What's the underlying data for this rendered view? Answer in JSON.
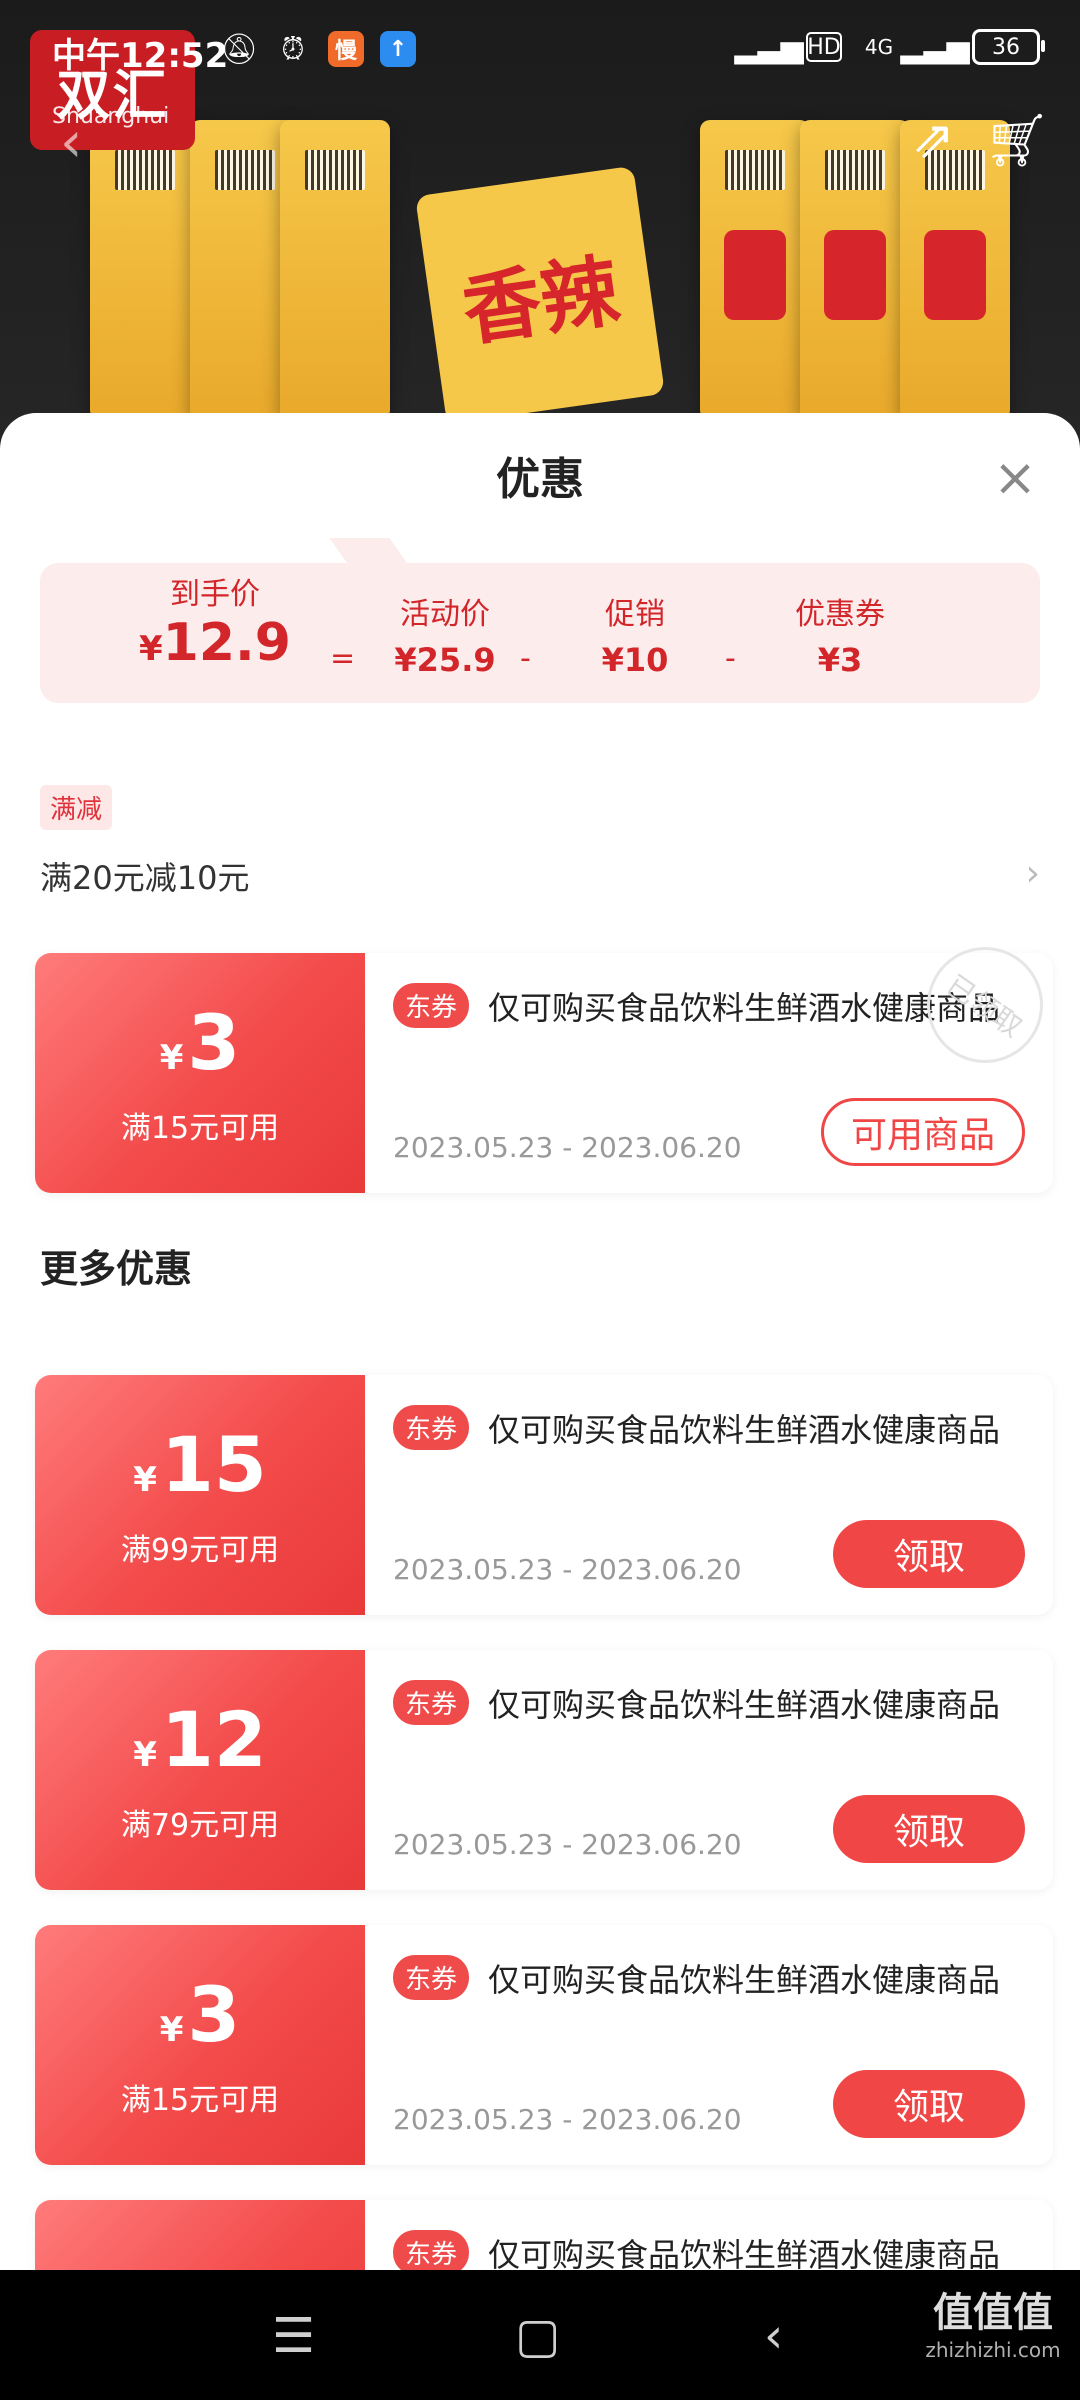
{
  "status_bar": {
    "time": "中午12:52",
    "app_badge": "慢",
    "network": "4G",
    "battery": "36"
  },
  "hero": {
    "logo": "双汇",
    "logo_sub": "Shuanghui",
    "text": "香辣"
  },
  "sheet": {
    "title": "优惠",
    "price_box": {
      "final_label": "到手价",
      "final_currency": "¥",
      "final_value": "12.9",
      "eq": "=",
      "activity_label": "活动价",
      "activity_value": "¥25.9",
      "minus": "-",
      "promo_label": "促销",
      "promo_value": "¥10",
      "coupon_label": "优惠券",
      "coupon_value": "¥3"
    },
    "tag": "满减",
    "rule": "满20元减10元",
    "more_title": "更多优惠"
  },
  "coupons": [
    {
      "amount": "3",
      "condition": "满15元可用",
      "badge": "东券",
      "description": "仅可购买食品饮料生鲜酒水健康商品",
      "date": "2023.05.23 - 2023.06.20",
      "button": "可用商品",
      "stamp": "已领取"
    },
    {
      "amount": "15",
      "condition": "满99元可用",
      "badge": "东券",
      "description": "仅可购买食品饮料生鲜酒水健康商品",
      "date": "2023.05.23 - 2023.06.20",
      "button": "领取"
    },
    {
      "amount": "12",
      "condition": "满79元可用",
      "badge": "东券",
      "description": "仅可购买食品饮料生鲜酒水健康商品",
      "date": "2023.05.23 - 2023.06.20",
      "button": "领取"
    },
    {
      "amount": "3",
      "condition": "满15元可用",
      "badge": "东券",
      "description": "仅可购买食品饮料生鲜酒水健康商品",
      "date": "2023.05.23 - 2023.06.20",
      "button": "领取"
    },
    {
      "badge": "东券",
      "description": "仅可购买食品饮料生鲜酒水健康商品"
    }
  ],
  "watermark": {
    "main": "值值值",
    "sub": "zhizhizhi.com"
  },
  "colors": {
    "accent": "#f14646",
    "price_bg": "#fdecec"
  }
}
